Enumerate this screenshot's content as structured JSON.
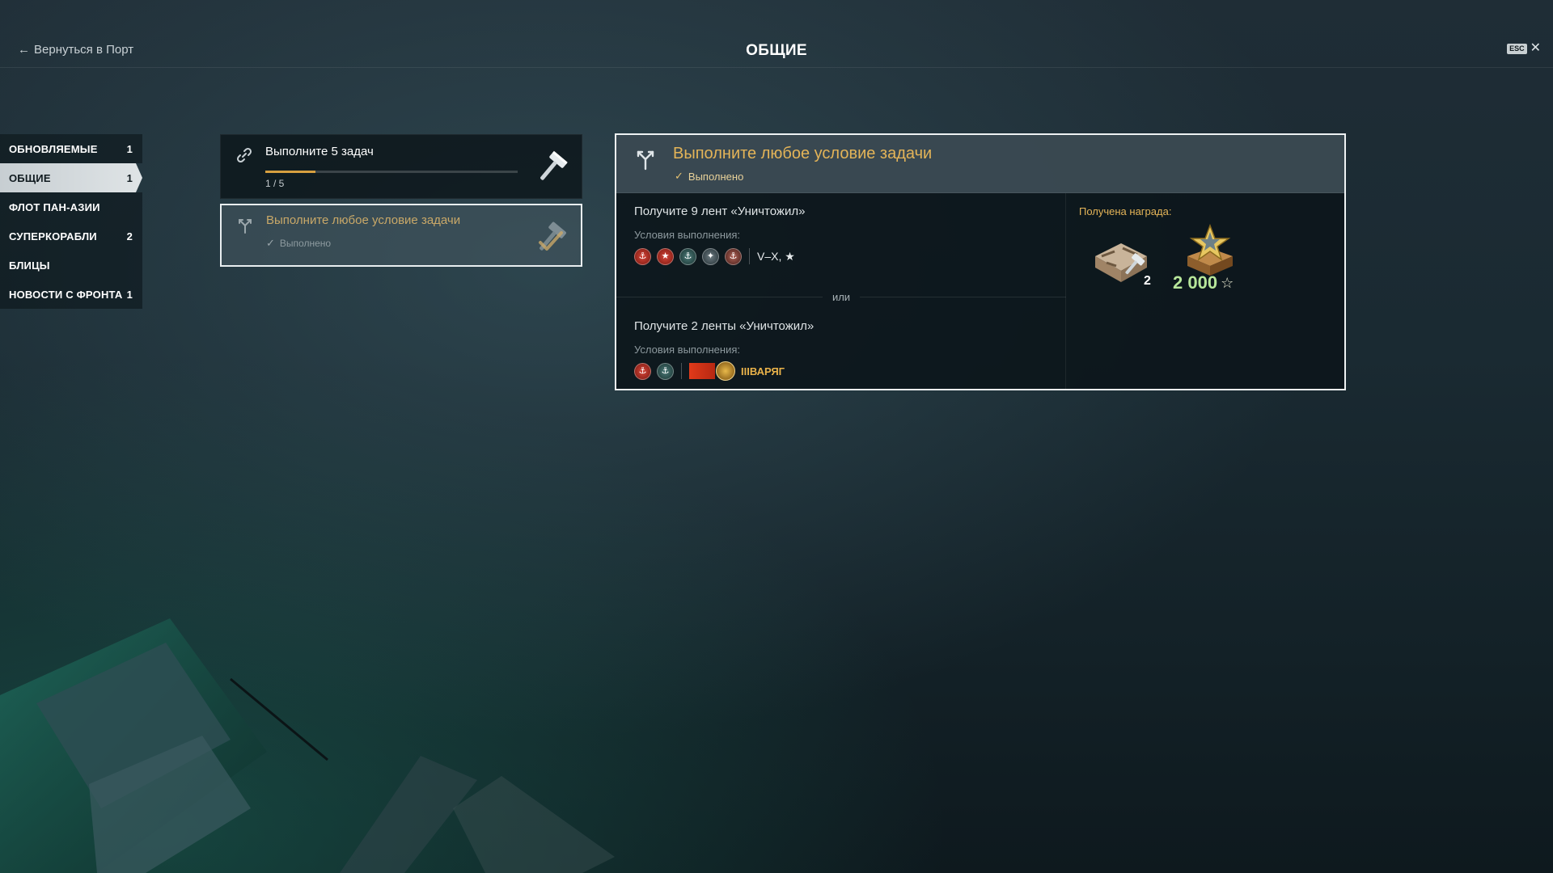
{
  "header": {
    "back_label": "Вернуться в Порт",
    "title": "ОБЩИЕ",
    "esc_label": "ESC"
  },
  "sidebar": {
    "items": [
      {
        "label": "ОБНОВЛЯЕМЫЕ",
        "count": "1"
      },
      {
        "label": "ОБЩИЕ",
        "count": "1",
        "active": true
      },
      {
        "label": "ФЛОТ ПАН-АЗИИ",
        "count": ""
      },
      {
        "label": "СУПЕРКОРАБЛИ",
        "count": "2"
      },
      {
        "label": "БЛИЦЫ",
        "count": ""
      },
      {
        "label": "НОВОСТИ С ФРОНТА",
        "count": "1"
      }
    ]
  },
  "tasks": [
    {
      "title": "Выполните 5 задач",
      "progress_text": "1 / 5",
      "progress_fraction": 0.2,
      "icon": "chain-icon",
      "reward_icon": "hammer-icon"
    },
    {
      "title": "Выполните любое условие задачи",
      "status": "Выполнено",
      "icon": "branch-icon",
      "reward_icon": "hammer-check-icon",
      "selected": true
    }
  ],
  "detail": {
    "title": "Выполните любое условие задачи",
    "status": "Выполнено",
    "or_label": "или",
    "conditions": [
      {
        "title": "Получите 9 лент «Уничтожил»",
        "label": "Условия выполнения:",
        "ship_classes": [
          "red",
          "red",
          "teal",
          "grey",
          "rose"
        ],
        "tiers": "V–X, ★"
      },
      {
        "title": "Получите 2 ленты «Уничтожил»",
        "label": "Условия выполнения:",
        "ship_classes": [
          "red",
          "teal"
        ],
        "ship_tier": "III",
        "ship_name": "ВАРЯГ"
      }
    ],
    "rewards": {
      "label": "Получена награда:",
      "crate_count": "2",
      "star_amount": "2 000"
    }
  },
  "colors": {
    "accent_gold": "#e4b458",
    "progress": "#d7a040",
    "star_green": "#b7e69a"
  }
}
